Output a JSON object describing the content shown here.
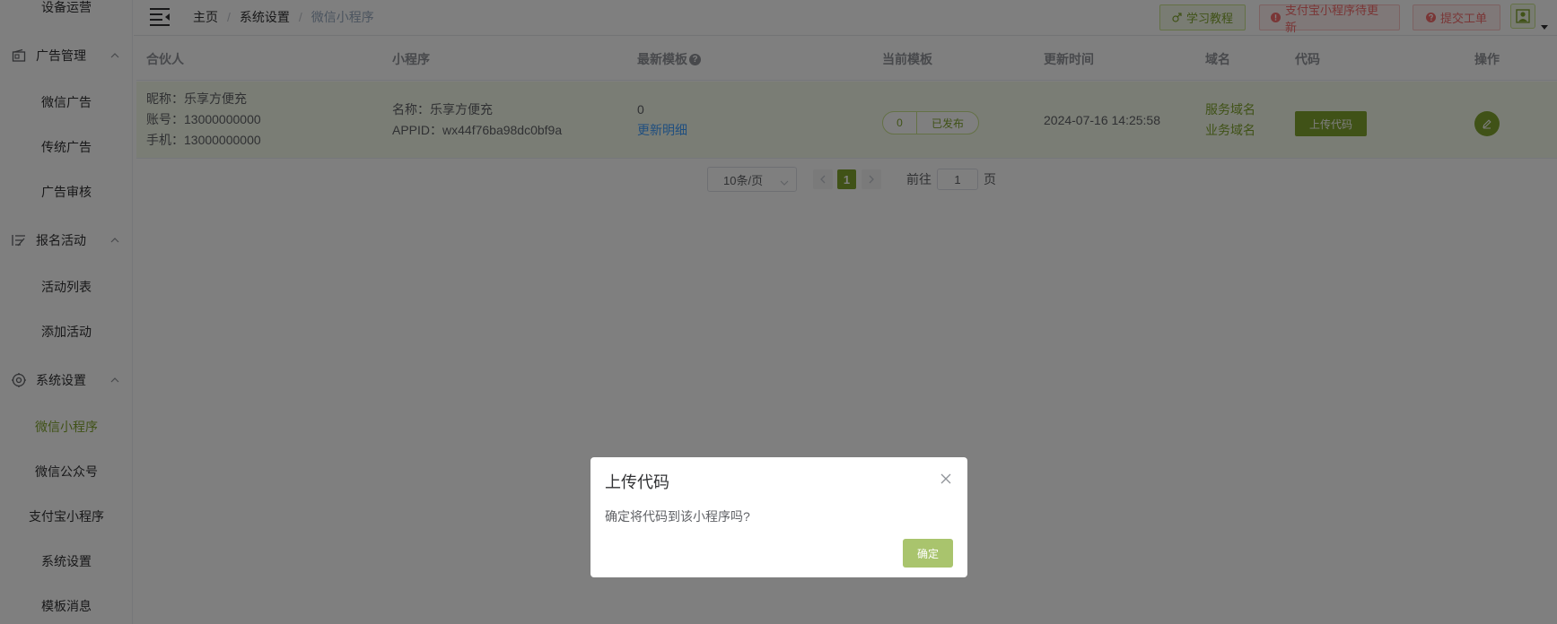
{
  "sidebar": {
    "top_partial": "设备运营",
    "groups": [
      {
        "label": "广告管理",
        "icon": "ad-icon",
        "items": [
          "微信广告",
          "传统广告",
          "广告审核"
        ]
      },
      {
        "label": "报名活动",
        "icon": "signup-icon",
        "items": [
          "活动列表",
          "添加活动"
        ]
      },
      {
        "label": "系统设置",
        "icon": "gear-icon",
        "items": [
          "微信小程序",
          "微信公众号",
          "支付宝小程序",
          "系统设置",
          "模板消息"
        ]
      }
    ],
    "active_item": "微信小程序"
  },
  "header": {
    "breadcrumb": [
      "主页",
      "系统设置",
      "微信小程序"
    ],
    "separator": "/",
    "buttons": {
      "learn": "学习教程",
      "alipay": "支付宝小程序待更新",
      "ticket": "提交工单"
    }
  },
  "table": {
    "columns": [
      "合伙人",
      "小程序",
      "最新模板",
      "当前模板",
      "更新时间",
      "域名",
      "代码",
      "操作"
    ],
    "rows": [
      {
        "partner": {
          "nickname": "昵称：乐享方便充",
          "account": "账号：13000000000",
          "phone": "手机：13000000000"
        },
        "mini": {
          "name": "名称：乐享方便充",
          "appid": "APPID：wx44f76ba98dc0bf9a"
        },
        "latest_template": {
          "value": "0",
          "link": "更新明细"
        },
        "current_template": {
          "value": "0",
          "status": "已发布"
        },
        "update_time": "2024-07-16 14:25:58",
        "domains": [
          "服务域名",
          "业务域名"
        ],
        "code_button": "上传代码"
      }
    ]
  },
  "pagination": {
    "page_size": "10条/页",
    "current_page": "1",
    "goto_label": "前往",
    "goto_value": "1",
    "page_suffix": "页"
  },
  "dialog": {
    "title": "上传代码",
    "message": "确定将代码到该小程序吗?",
    "confirm": "确定"
  },
  "colors": {
    "primary": "#80a52f",
    "danger": "#f56c6c",
    "link": "#409eff",
    "overlay": "rgba(0,0,0,0.5)"
  }
}
